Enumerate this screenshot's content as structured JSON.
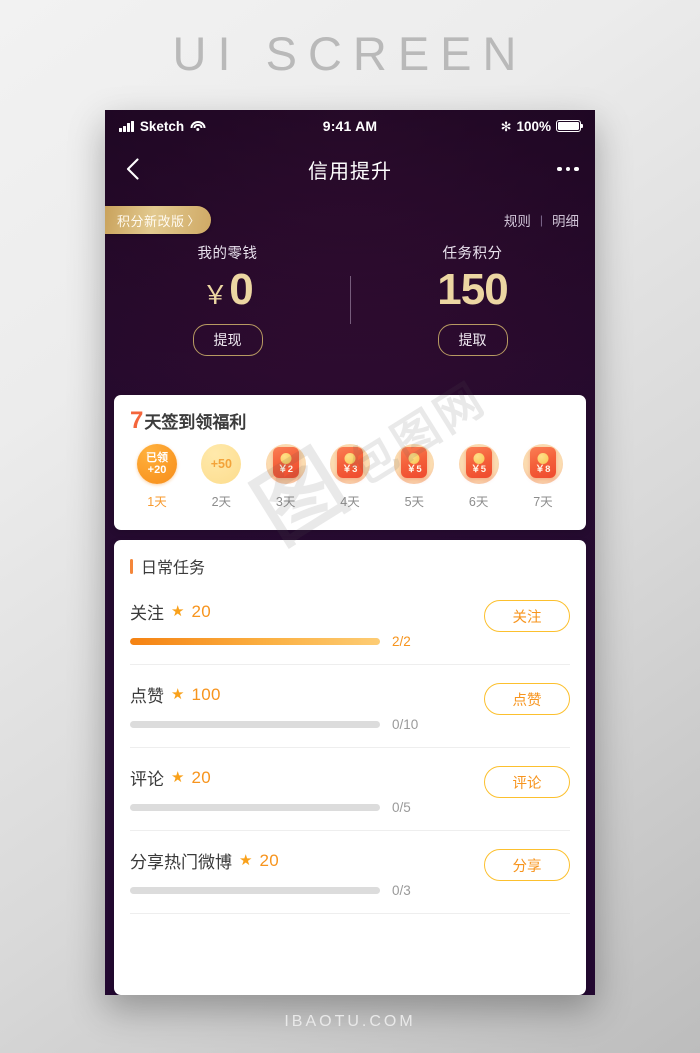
{
  "page": {
    "heading": "UI SCREEN",
    "footer": "IBAOTU.COM"
  },
  "colors": {
    "accent_gold": "#ecd6a2",
    "accent_orange": "#f7941d",
    "packet_red": "#f4603a",
    "bg_purple": "#2c0b2f"
  },
  "status_bar": {
    "carrier": "Sketch",
    "time": "9:41 AM",
    "battery": "100%",
    "signal_icon": "signal-bars-icon",
    "wifi_icon": "wifi-icon",
    "bluetooth_icon": "bluetooth-icon",
    "bluetooth_glyph": "✻"
  },
  "nav": {
    "back_icon": "chevron-left-icon",
    "title": "信用提升",
    "more_icon": "more-dots-icon"
  },
  "promo": {
    "badge_label": "积分新改版",
    "badge_chevron": "〉",
    "links": [
      {
        "label": "规则"
      },
      {
        "label": "明细"
      }
    ],
    "separator": "|"
  },
  "balance": {
    "columns": [
      {
        "label": "我的零钱",
        "currency": "￥",
        "value": "0",
        "button": "提现"
      },
      {
        "label": "任务积分",
        "currency": "",
        "value": "150",
        "button": "提取"
      }
    ]
  },
  "checkin": {
    "title_number": "7",
    "title_text": "天签到领福利",
    "days": [
      {
        "state": "claimed",
        "line1": "已领",
        "line2": "+20",
        "label": "1天",
        "active": true
      },
      {
        "state": "pending",
        "line1": "+50",
        "line2": "",
        "label": "2天",
        "active": false
      },
      {
        "state": "packet",
        "amount": "￥2",
        "label": "3天",
        "active": false
      },
      {
        "state": "packet",
        "amount": "￥3",
        "label": "4天",
        "active": false
      },
      {
        "state": "packet",
        "amount": "￥5",
        "label": "5天",
        "active": false
      },
      {
        "state": "packet",
        "amount": "￥5",
        "label": "6天",
        "active": false
      },
      {
        "state": "packet",
        "amount": "￥8",
        "label": "7天",
        "active": false
      }
    ]
  },
  "tasks": {
    "heading": "日常任务",
    "star_glyph": "★",
    "items": [
      {
        "name": "关注",
        "points": "20",
        "progress_text": "2/2",
        "progress_pct": 100,
        "button": "关注",
        "complete": true
      },
      {
        "name": "点赞",
        "points": "100",
        "progress_text": "0/10",
        "progress_pct": 0,
        "button": "点赞",
        "complete": false
      },
      {
        "name": "评论",
        "points": "20",
        "progress_text": "0/5",
        "progress_pct": 0,
        "button": "评论",
        "complete": false
      },
      {
        "name": "分享热门微博",
        "points": "20",
        "progress_text": "0/3",
        "progress_pct": 0,
        "button": "分享",
        "complete": false
      }
    ]
  },
  "watermark": {
    "mark1": "图",
    "mark2": "包图网"
  }
}
